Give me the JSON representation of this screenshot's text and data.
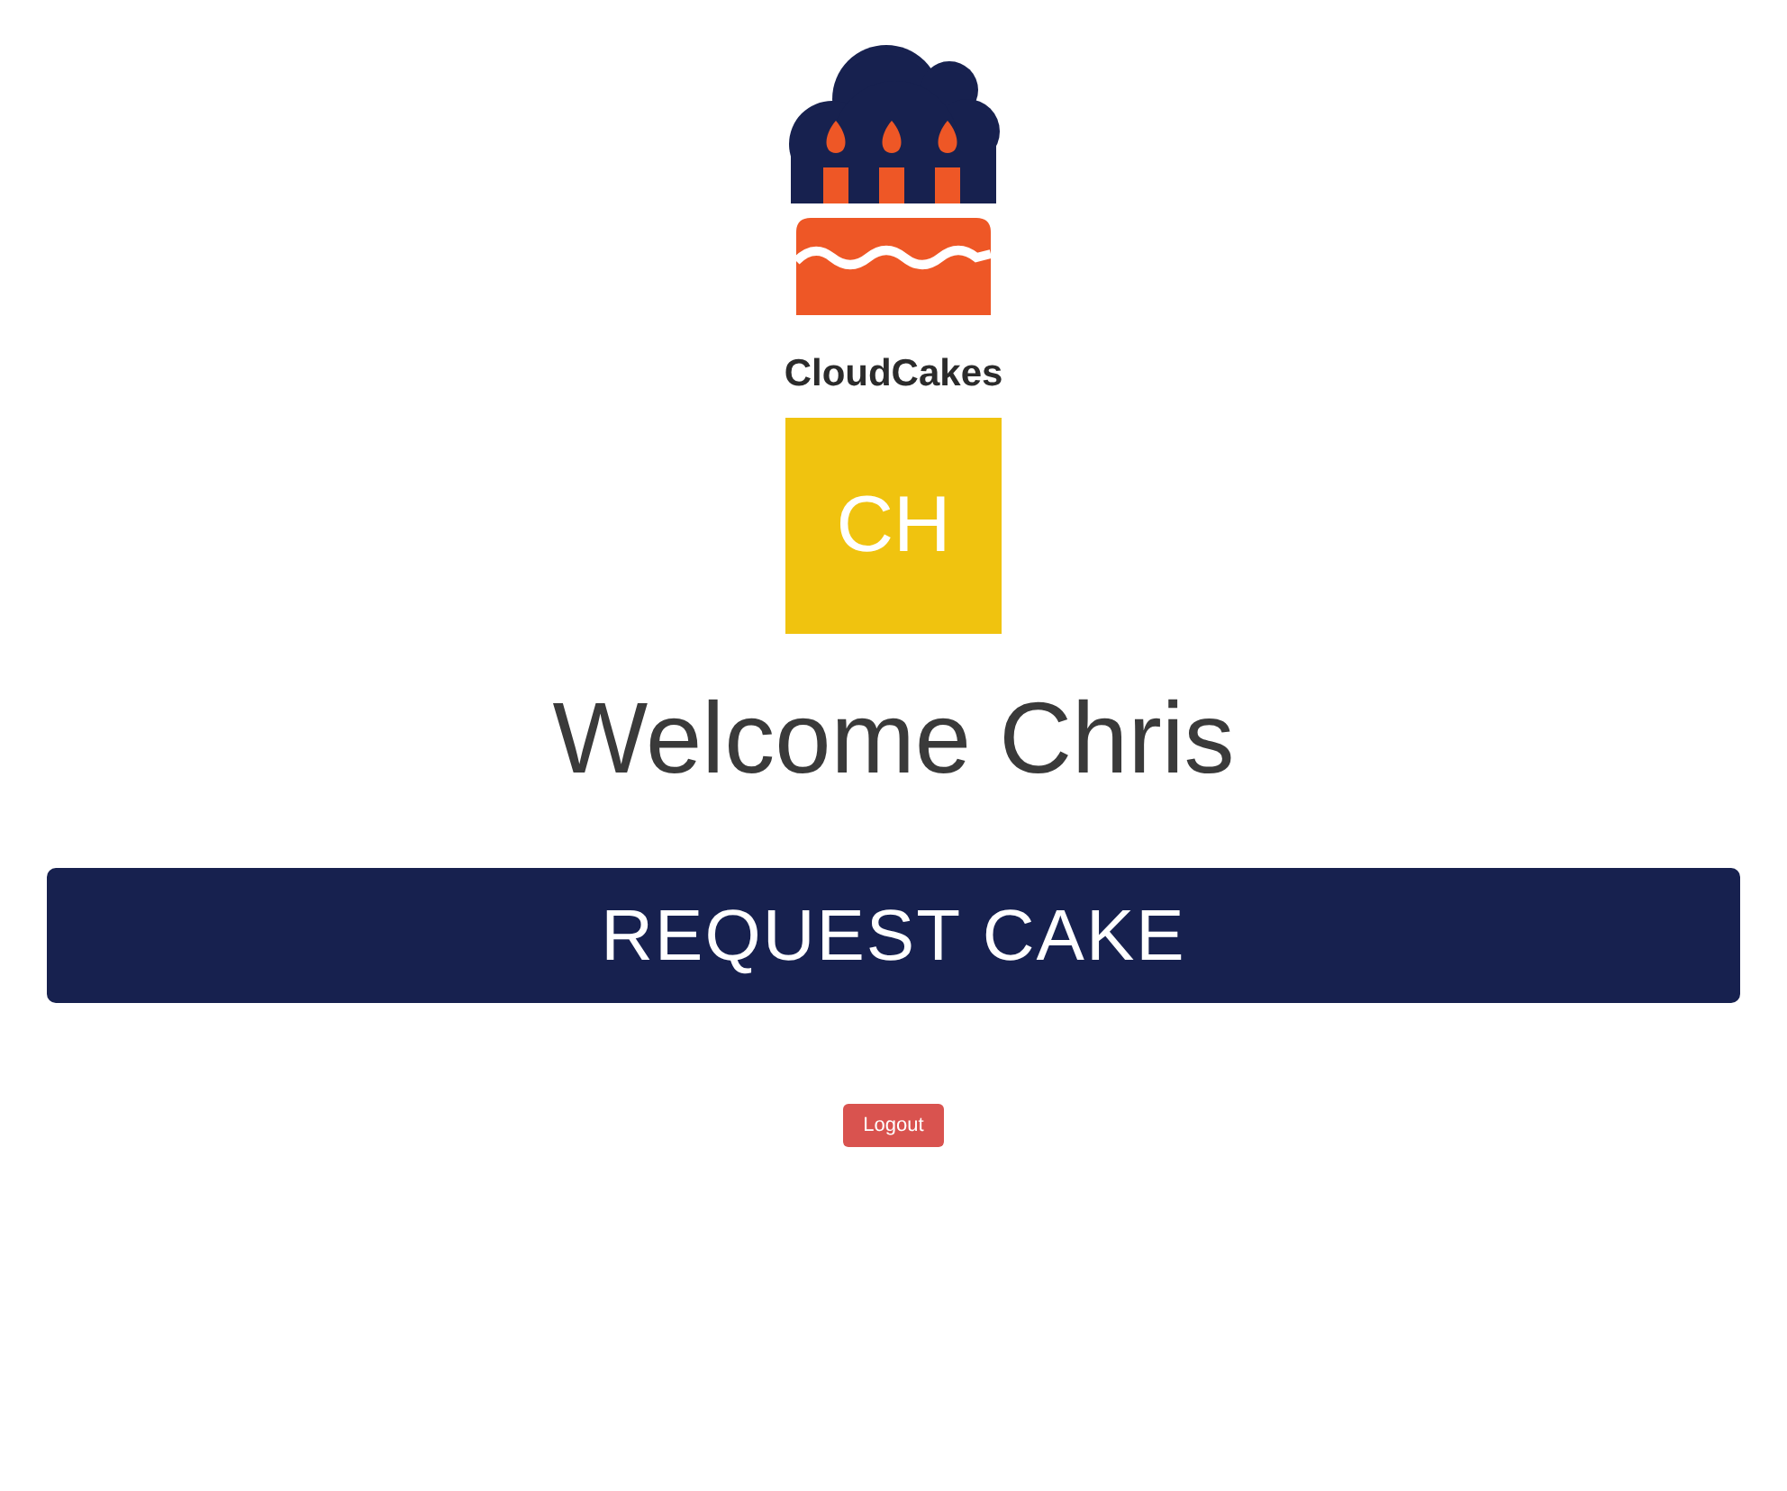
{
  "brand": {
    "name": "CloudCakes"
  },
  "user": {
    "initials": "CH",
    "greeting": "Welcome Chris"
  },
  "buttons": [
    {
      "kind": "primary",
      "label": "REQUEST CAKE"
    },
    {
      "kind": "danger",
      "label": "Logout"
    }
  ]
}
